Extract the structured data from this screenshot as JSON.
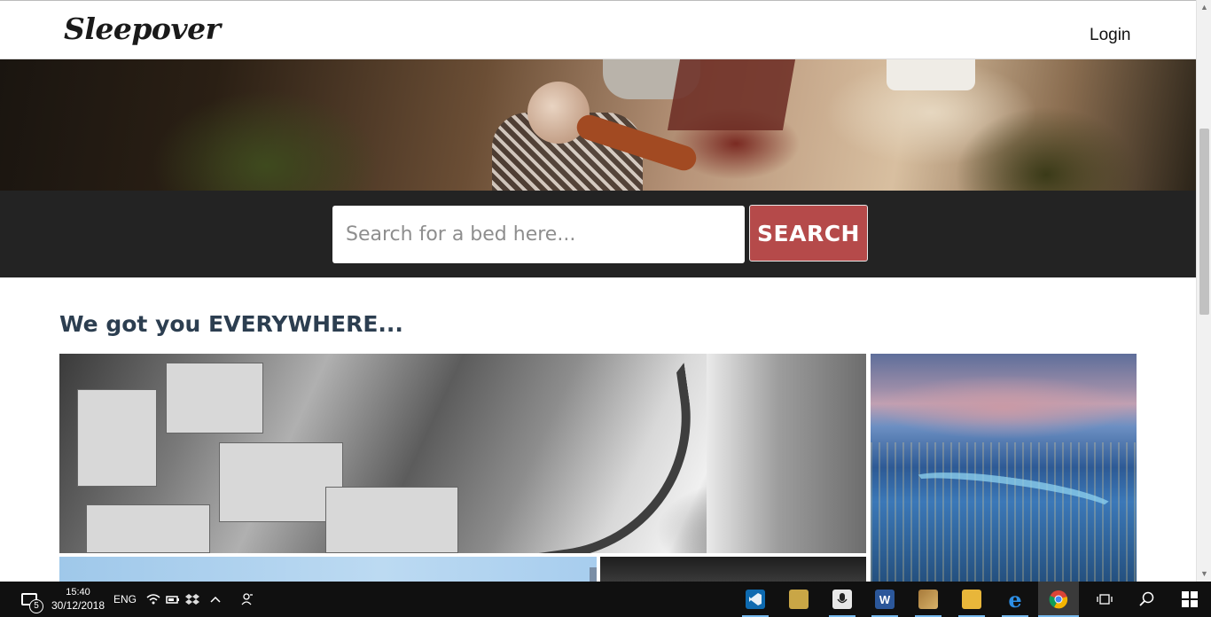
{
  "header": {
    "logo": "Sleepover",
    "login_label": "Login"
  },
  "search": {
    "placeholder": "Search for a bed here...",
    "button_label": "SEARCH"
  },
  "section": {
    "title": "We got you EVERYWHERE..."
  },
  "taskbar": {
    "notification_count": "5",
    "time": "15:40",
    "date": "30/12/2018",
    "language": "ENG",
    "apps": [
      {
        "name": "vscode",
        "label": ""
      },
      {
        "name": "photos",
        "label": ""
      },
      {
        "name": "voice",
        "label": ""
      },
      {
        "name": "word",
        "label": "W"
      },
      {
        "name": "app",
        "label": ""
      },
      {
        "name": "file-explorer",
        "label": ""
      },
      {
        "name": "edge",
        "label": "e"
      },
      {
        "name": "chrome",
        "label": ""
      }
    ]
  },
  "colors": {
    "search_button": "#b54a4a",
    "search_band": "#232323",
    "section_title": "#2c3e50",
    "taskbar": "#101010"
  }
}
